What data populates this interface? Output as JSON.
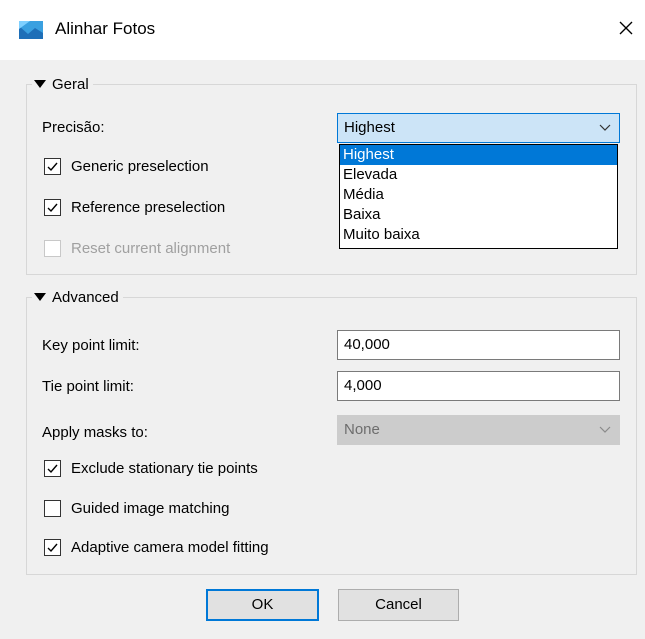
{
  "window": {
    "title": "Alinhar Fotos",
    "close_icon": "close-icon",
    "app_icon": "photoscan-icon"
  },
  "general": {
    "title": "Geral",
    "precision_label": "Precisão:",
    "precision_value": "Highest",
    "precision_options": [
      "Highest",
      "Elevada",
      "Média",
      "Baixa",
      "Muito baixa"
    ],
    "precision_selected_index": 0,
    "generic_preselection": {
      "label": "Generic preselection",
      "checked": true
    },
    "reference_preselection": {
      "label": "Reference preselection",
      "checked": true
    },
    "reset_alignment": {
      "label": "Reset current alignment",
      "checked": false,
      "enabled": false
    }
  },
  "advanced": {
    "title": "Advanced",
    "key_point_limit_label": "Key point limit:",
    "key_point_limit": "40,000",
    "tie_point_limit_label": "Tie point limit:",
    "tie_point_limit": "4,000",
    "apply_masks_label": "Apply masks to:",
    "apply_masks_value": "None",
    "exclude_stationary": {
      "label": "Exclude stationary tie points",
      "checked": true
    },
    "guided_matching": {
      "label": "Guided image matching",
      "checked": false
    },
    "adaptive_fitting": {
      "label": "Adaptive camera model fitting",
      "checked": true
    }
  },
  "buttons": {
    "ok": "OK",
    "cancel": "Cancel"
  },
  "colors": {
    "accent": "#0078d7",
    "selection_bg": "#cce4f7",
    "dialog_bg": "#f0f0f0"
  }
}
